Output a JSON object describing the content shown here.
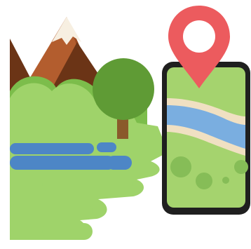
{
  "illustration": {
    "subject": "nature-landscape-with-map-app",
    "colors": {
      "mountain_dark": "#6b3416",
      "mountain_mid": "#9a4a22",
      "mountain_light": "#b35d2e",
      "snow": "#f7efe1",
      "grass_light": "#9fd36a",
      "grass_dark": "#7cbd4b",
      "tree_crown": "#5f9b35",
      "tree_trunk": "#8a5a2b",
      "lake": "#4d86c6",
      "phone_frame": "#1f1f1f",
      "map_land": "#a5d36e",
      "map_river": "#7aaee0",
      "map_river_bank": "#f0e0c2",
      "map_spots": "#86bd57",
      "pin": "#ec5b5e",
      "pin_hole": "#ffffff"
    },
    "icons": [
      "mountain-icon",
      "tree-icon",
      "lake-icon",
      "smartphone-icon",
      "location-pin-icon",
      "map-icon"
    ]
  }
}
